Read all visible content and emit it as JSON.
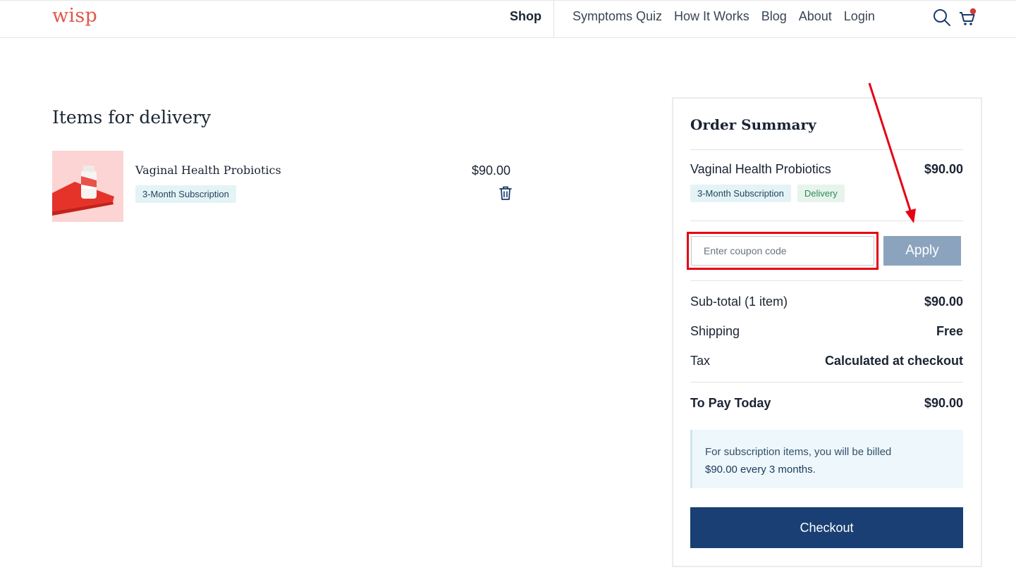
{
  "header": {
    "logo": "wisp",
    "nav_active": "Shop",
    "nav_links": [
      "Symptoms Quiz",
      "How It Works",
      "Blog",
      "About",
      "Login"
    ],
    "icons": [
      "search-icon",
      "cart-icon"
    ],
    "cart_dot_color": "#d33a3a"
  },
  "cart": {
    "title": "Items for delivery",
    "item": {
      "name": "Vaginal Health Probiotics",
      "badge": "3-Month Subscription",
      "price": "$90.00"
    }
  },
  "summary": {
    "title": "Order Summary",
    "item_name": "Vaginal Health Probiotics",
    "item_price": "$90.00",
    "badge_subscription": "3-Month Subscription",
    "badge_delivery": "Delivery",
    "coupon_placeholder": "Enter coupon code",
    "apply_label": "Apply",
    "subtotal_label": "Sub-total (1 item)",
    "subtotal_value": "$90.00",
    "shipping_label": "Shipping",
    "shipping_value": "Free",
    "tax_label": "Tax",
    "tax_value": "Calculated at checkout",
    "total_label": "To Pay Today",
    "total_value": "$90.00",
    "notice_line1": "For subscription items, you will be billed",
    "notice_amount": "$90.00 every 3 months",
    "notice_end": ".",
    "checkout_label": "Checkout"
  },
  "colors": {
    "brand": "#e2574c",
    "primary_button": "#193f74",
    "apply_button": "#8ba3bd",
    "highlight": "#e60012"
  }
}
